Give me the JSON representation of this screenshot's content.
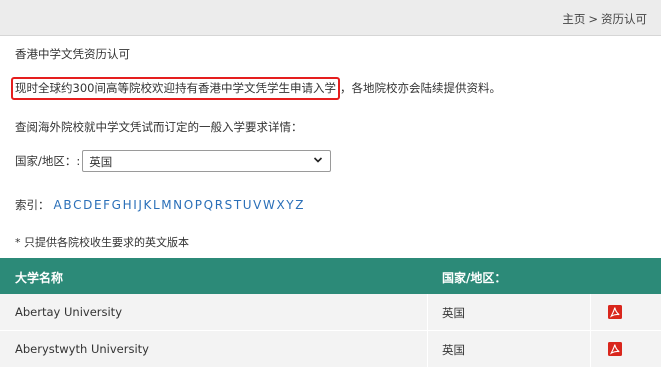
{
  "breadcrumb": {
    "home": "主页",
    "separator": ">",
    "current": "资历认可"
  },
  "heading": "香港中学文凭资历认可",
  "intro": {
    "highlighted": "现时全球约300间高等院校欢迎持有香港中学文凭学生申请入学",
    "rest": "，各地院校亦会陆续提供资料。"
  },
  "query_text": "查阅海外院校就中学文凭试而订定的一般入学要求详情：",
  "country_filter": {
    "label": "国家/地区：:",
    "selected": "英国"
  },
  "index": {
    "label": "索引：",
    "letters": [
      "A",
      "B",
      "C",
      "D",
      "E",
      "F",
      "G",
      "H",
      "I",
      "J",
      "K",
      "L",
      "M",
      "N",
      "O",
      "P",
      "Q",
      "R",
      "S",
      "T",
      "U",
      "V",
      "W",
      "X",
      "Y",
      "Z"
    ]
  },
  "note": "* 只提供各院校收生要求的英文版本",
  "table": {
    "headers": {
      "name": "大学名称",
      "country": "国家/地区："
    },
    "rows": [
      {
        "name": "Abertay University",
        "country": "英国",
        "icon": "pdf-icon"
      },
      {
        "name": "Aberystwyth University",
        "country": "英国",
        "icon": "pdf-icon"
      }
    ]
  },
  "colors": {
    "header_bg": "#2c8a78",
    "link": "#2a6fb8",
    "highlight_border": "#e51e1e",
    "pdf_red": "#d9261c"
  }
}
